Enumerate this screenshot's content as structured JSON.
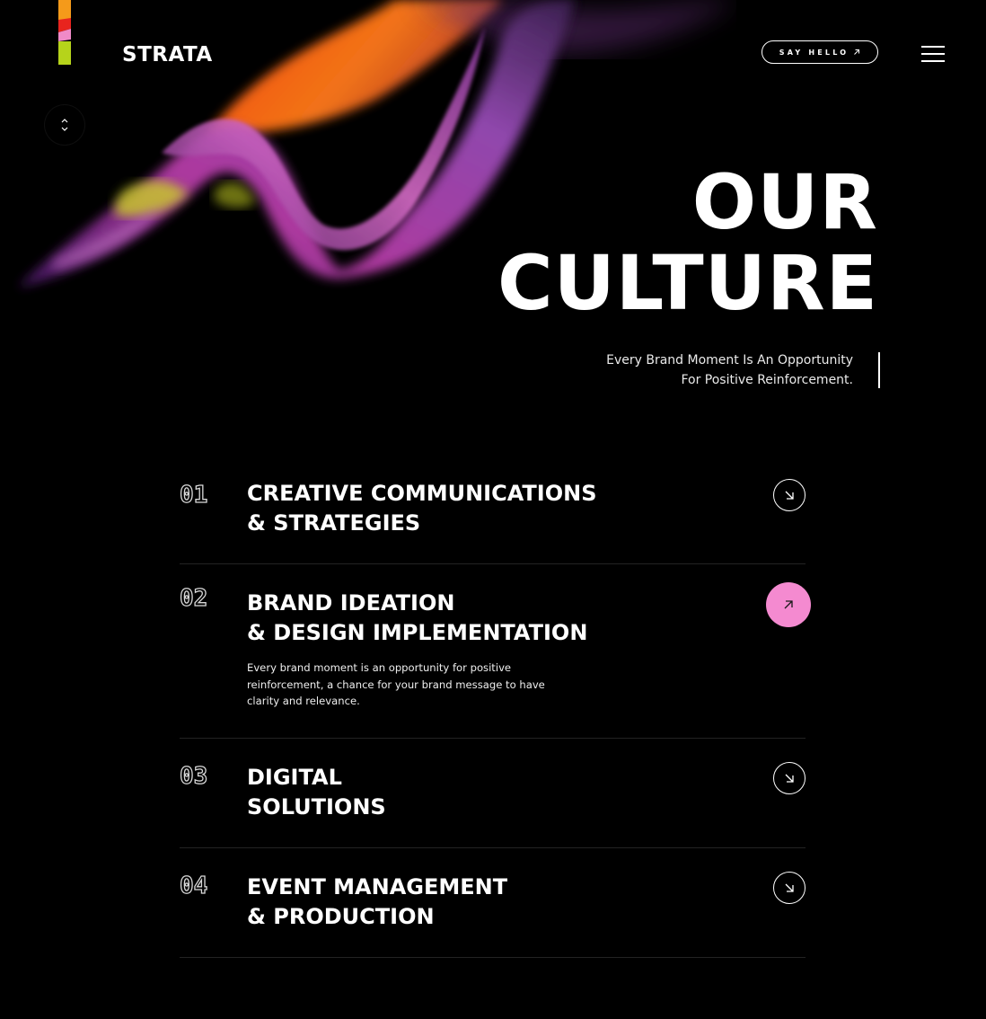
{
  "header": {
    "brand": "STRATA",
    "say_hello_label": "SAY HELLO",
    "say_hello_icon": "arrow-up-right-icon",
    "menu_icon": "hamburger-menu-icon"
  },
  "scroll_button": {
    "icon": "chevron-up-down-icon"
  },
  "hero": {
    "title_line1": "OUR",
    "title_line2": "CULTURE",
    "tagline_line1": "Every Brand Moment Is An Opportunity",
    "tagline_line2": "For Positive Reinforcement."
  },
  "services": [
    {
      "number": "01",
      "title_line1": "CREATIVE COMMUNICATIONS",
      "title_line2": "& STRATEGIES",
      "description": "",
      "expanded": false,
      "icon": "arrow-down-right-icon"
    },
    {
      "number": "02",
      "title_line1": "BRAND IDEATION",
      "title_line2": "& DESIGN IMPLEMENTATION",
      "description": "Every brand moment is an opportunity for positive reinforcement, a chance for your brand message to have clarity and relevance.",
      "expanded": true,
      "icon": "arrow-up-right-icon"
    },
    {
      "number": "03",
      "title_line1": "DIGITAL",
      "title_line2": "SOLUTIONS",
      "description": "",
      "expanded": false,
      "icon": "arrow-down-right-icon"
    },
    {
      "number": "04",
      "title_line1": "EVENT MANAGEMENT",
      "title_line2": "& PRODUCTION",
      "description": "",
      "expanded": false,
      "icon": "arrow-down-right-icon"
    }
  ],
  "colors": {
    "background": "#000000",
    "accent_pink": "#f48ad0",
    "logo_stripe": [
      "#f59a1a",
      "#e8241e",
      "#f08ac8",
      "#b6d31b"
    ]
  }
}
